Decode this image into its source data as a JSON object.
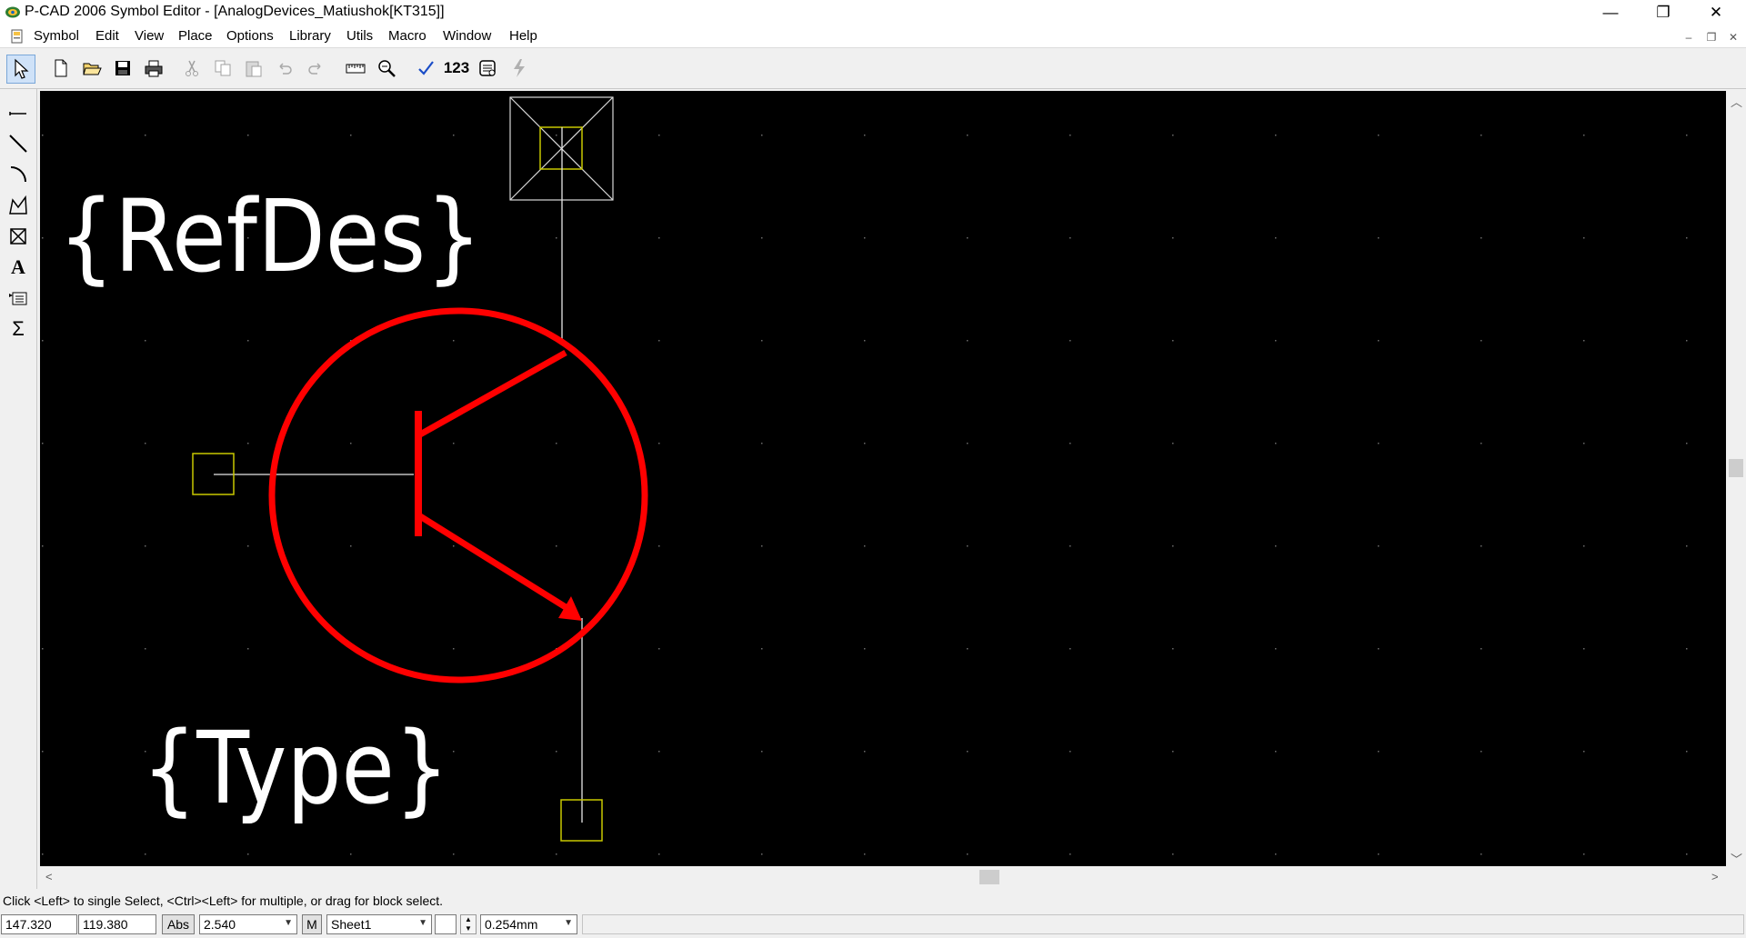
{
  "window": {
    "title": "P-CAD 2006 Symbol Editor - [AnalogDevices_Matiushok[KT315]]",
    "minimize_glyph": "—",
    "restore_glyph": "❐",
    "close_glyph": "✕"
  },
  "menu": [
    "Symbol",
    "Edit",
    "View",
    "Place",
    "Options",
    "Library",
    "Utils",
    "Macro",
    "Window",
    "Help"
  ],
  "mdi_controls": {
    "minimize": "–",
    "restore": "❐",
    "close": "✕"
  },
  "toolbar": {
    "pin_numbers_label": "123",
    "icons": [
      "select-arrow-icon",
      "new-file-icon",
      "open-folder-icon",
      "save-icon",
      "print-icon",
      "cut-icon",
      "copy-icon",
      "paste-icon",
      "undo-icon",
      "redo-icon",
      "measure-ruler-icon",
      "zoom-icon",
      "check-icon",
      "pin-numbers-icon",
      "symbol-wizard-icon",
      "run-icon"
    ]
  },
  "left_tools": [
    "place-pin-icon",
    "place-line-icon",
    "place-arc-icon",
    "place-polygon-icon",
    "place-ref-point-icon",
    "place-text-icon",
    "place-attribute-icon",
    "place-field-icon"
  ],
  "canvas": {
    "refdes_label": "{RefDes}",
    "type_label": "{Type}",
    "background_color": "#000000",
    "symbol_color": "#ff0000",
    "pin_color": "#c8c800",
    "grid_color": "#6a6a6a"
  },
  "status": {
    "hint": "Click <Left> to single Select, <Ctrl><Left> for multiple, or drag for block select.",
    "x_coord": "147.320",
    "y_coord": "119.380",
    "abs_label": "Abs",
    "grid_value": "2.540",
    "m_label": "M",
    "sheet": "Sheet1",
    "line_width": "0.254mm"
  }
}
